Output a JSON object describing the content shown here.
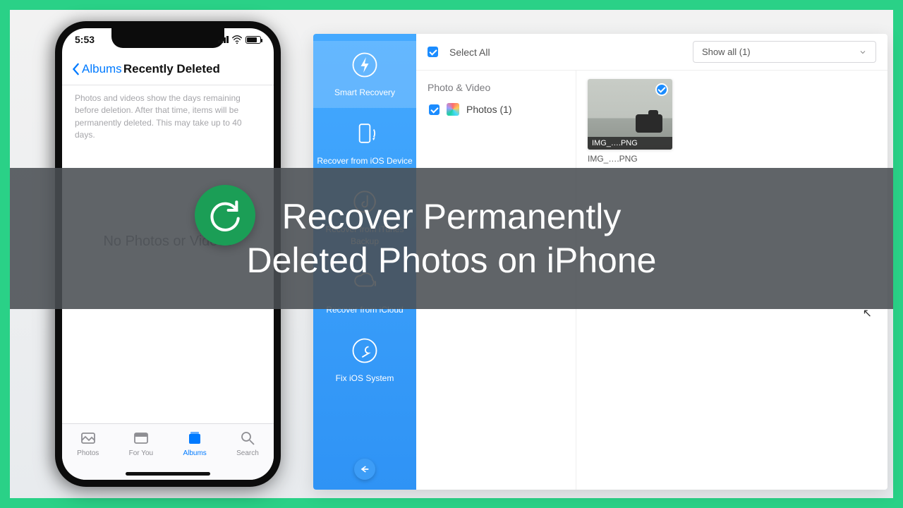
{
  "overlay": {
    "title_line1": "Recover Permanently",
    "title_line2": "Deleted Photos on iPhone"
  },
  "phone": {
    "time": "5:53",
    "back_label": "Albums",
    "screen_title": "Recently Deleted",
    "help_text": "Photos and videos show the days remaining before deletion. After that time, items will be permanently deleted. This may take up to 40 days.",
    "empty_label": "No Photos or Videos",
    "tabs": {
      "photos": "Photos",
      "for_you": "For You",
      "albums": "Albums",
      "search": "Search"
    }
  },
  "app": {
    "sidebar": {
      "smart": "Smart Recovery",
      "ios": "Recover from iOS Device",
      "itunes": "Recover from iTunes Backup",
      "icloud": "Recover from iCloud",
      "fix": "Fix iOS System"
    },
    "topbar": {
      "select_all": "Select All",
      "filter_label": "Show all (1)"
    },
    "tree": {
      "group": "Photo & Video",
      "photos_label": "Photos (1)"
    },
    "thumb": {
      "caption": "IMG_….PNG",
      "filename": "IMG_….PNG"
    }
  }
}
